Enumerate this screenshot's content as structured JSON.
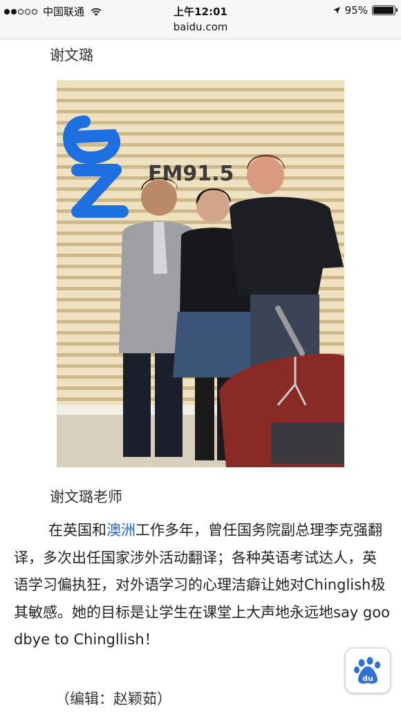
{
  "status_bar": {
    "signal_bars_filled": 2,
    "signal_bars_total": 5,
    "carrier": "中国联通",
    "time": "上午12:01",
    "battery_percent": "95%",
    "battery_level": 0.95
  },
  "url_bar": {
    "domain": "baidu.com"
  },
  "article": {
    "heading": "谢文璐",
    "photo_caption": "谢文璐老师",
    "photo_sign_text": "FM91.5",
    "body_before_link": "在英国和",
    "body_link": "澳洲",
    "body_after_link": "工作多年，曾任国务院副总理李克强翻译，多次出任国家涉外活动翻译；各种英语考试达人，英语学习偏执狂，对外语学习的心理洁癖让她对Chinglish极其敏感。她的目标是让学生在课堂上大声地永远地say goodbye to Chingllish！",
    "editor": "（编辑：赵颖茹）"
  },
  "icons": {
    "wifi": "wifi-icon",
    "location": "location-arrow-icon",
    "battery": "battery-icon",
    "baidu": "baidu-paw-icon"
  },
  "colors": {
    "link": "#2a65b8",
    "baidu_blue": "#2f6fd6"
  }
}
